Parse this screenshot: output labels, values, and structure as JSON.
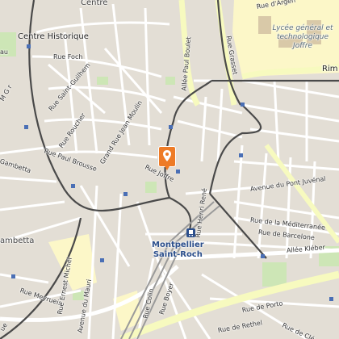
{
  "map": {
    "colors": {
      "background": "#f2efe9",
      "block": "#e0dbd2",
      "park": "#cde6b6",
      "school": "#fcf7c8",
      "street": "#ffffff",
      "main_road": "#f7fabf",
      "tram": "#4a4a4a",
      "rail": "#9a9a9a",
      "pin": "#ee7b26",
      "station": "#2c4f8c"
    },
    "labels": {
      "centre_top": "Centre",
      "centre_historique": "Centre Historique",
      "rue_foch": "Rue Foch",
      "rue_saint_guilhem": "Rue Saint-Guilhem",
      "rue_roucher": "Rue Roucher",
      "grand_rue": "Grand Rue Jean Moulin",
      "rue_paul_brousse": "Rue Paul Brousse",
      "gambetta_street": "Gambetta",
      "gambetta_district": "ambetta",
      "rue_meyrueis": "Rue Meyrueis",
      "rue_ernest_michel": "Rue Ernest Michel",
      "av_maurin": "Avenue du Mauri",
      "rue_joffre": "Rue Joffre",
      "allee_paul_boulet": "Allée Paul Boulet",
      "rue_argencourt": "Rue d'Argen",
      "rim": "Rim",
      "lycee": "Lycée général et technologique Joffre",
      "av_pont_juvenal": "Avenue du Pont Juvénal",
      "rue_mediterranee": "Rue de la Méditerranée",
      "rue_barcelone": "Rue de Barcelone",
      "allee_kleber": "Allée Kléber",
      "rue_henri_rene": "Rue Henri René",
      "rue_colin": "Rue Colin",
      "rue_boyer": "Rue Boyer",
      "rue_porto": "Rue de Porto",
      "rue_rethel": "Rue de Rethel",
      "rue_cle": "Rue de Clé",
      "rue_grasset": "Rue Grasset",
      "gau": "au",
      "mgr": "M G r",
      "ue": "ue"
    },
    "station": {
      "name_line1": "Montpellier",
      "name_line2": "Saint-Roch"
    },
    "pin_icon": "location-pin-icon",
    "station_icon": "train-station-icon"
  }
}
